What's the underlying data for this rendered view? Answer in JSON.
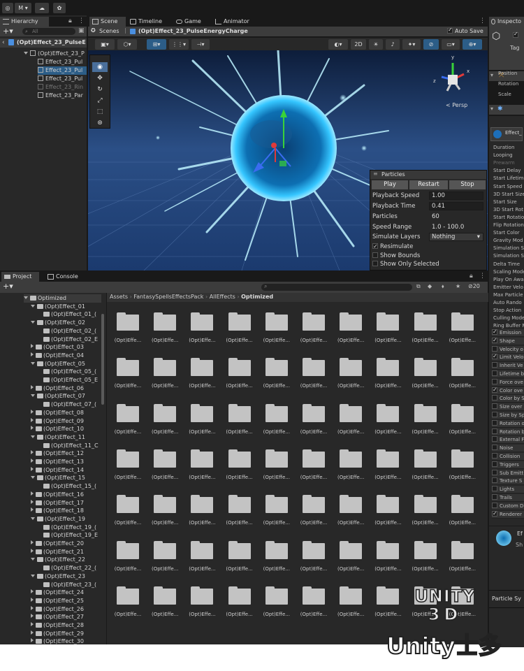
{
  "toolbar": {
    "account": "M",
    "account_caret": "▾",
    "cloud": "☁",
    "gear": "✿"
  },
  "hierarchy": {
    "tab": "Hierarchy",
    "search_placeholder": "All",
    "scene_root": "(Opt)Effect_23_PulseE",
    "rows": [
      "(Opt)Effect_23_P",
      "Effect_23_Pul",
      "Effect_23_Pul",
      "Effect_23_Pul",
      "Effect_23_Rin",
      "Effect_23_Par"
    ]
  },
  "scene": {
    "tabs": [
      "Scene",
      "Timeline",
      "Game",
      "Animator"
    ],
    "breadcrumb_scenes": "Scenes",
    "breadcrumb_prefab": "(Opt)Effect_23_PulseEnergyCharge",
    "auto_save": "Auto Save",
    "mode_2d": "2D",
    "persp": "< Persp",
    "gizmo_axes": {
      "y": "y",
      "x": "x",
      "z": "z"
    }
  },
  "particles_overlay": {
    "title": "Particles",
    "buttons": [
      "Play",
      "Restart",
      "Stop"
    ],
    "fields": [
      {
        "label": "Playback Speed",
        "value": "1.00"
      },
      {
        "label": "Playback Time",
        "value": "0.41"
      },
      {
        "label": "Particles",
        "value": "60"
      },
      {
        "label": "Speed Range",
        "value": "1.0 - 100.0"
      },
      {
        "label": "Simulate Layers",
        "value": "Nothing"
      }
    ],
    "checks": [
      {
        "label": "Resimulate",
        "checked": true
      },
      {
        "label": "Show Bounds",
        "checked": false
      },
      {
        "label": "Show Only Selected",
        "checked": false
      }
    ]
  },
  "inspector": {
    "tab": "Inspecto",
    "tag": "Tag",
    "transform_rows": [
      "Position",
      "Rotation",
      "Scale"
    ],
    "effect_name": "Effect_",
    "main_rows": [
      "Duration",
      "Looping",
      "Prewarm",
      "Start Delay",
      "Start Lifetim",
      "Start Speed",
      "3D Start Size",
      "Start Size",
      "3D Start Rot",
      "Start Rotatio",
      "Flip Rotation",
      "Start Color",
      "Gravity Mod",
      "Simulation S",
      "Simulation S",
      "Delta Time",
      "Scaling Mode",
      "Play On Awa",
      "Emitter Velo",
      "Max Particle",
      "Auto Rando",
      "Stop Action",
      "Culling Mode",
      "Ring Buffer M"
    ],
    "modules": [
      {
        "label": "Emission",
        "checked": true
      },
      {
        "label": "Shape",
        "checked": true
      },
      {
        "label": "Velocity o",
        "checked": false
      },
      {
        "label": "Limit Velo",
        "checked": true
      },
      {
        "label": "Inherit Ve",
        "checked": false
      },
      {
        "label": "Lifetime b",
        "checked": false
      },
      {
        "label": "Force ove",
        "checked": false
      },
      {
        "label": "Color ove",
        "checked": true
      },
      {
        "label": "Color by S",
        "checked": false
      },
      {
        "label": "Size over",
        "checked": false
      },
      {
        "label": "Size by Sp",
        "checked": false
      },
      {
        "label": "Rotation o",
        "checked": false
      },
      {
        "label": "Rotation b",
        "checked": false
      },
      {
        "label": "External F",
        "checked": false
      },
      {
        "label": "Noise",
        "checked": false
      },
      {
        "label": "Collision",
        "checked": false
      },
      {
        "label": "Triggers",
        "checked": false
      },
      {
        "label": "Sub Emitt",
        "checked": false
      },
      {
        "label": "Texture S",
        "checked": false
      },
      {
        "label": "Lights",
        "checked": false
      },
      {
        "label": "Trails",
        "checked": false
      },
      {
        "label": "Custom D",
        "checked": false
      },
      {
        "label": "Renderer",
        "checked": true
      }
    ],
    "material_name": "Ef",
    "material_sub": "Sh",
    "particle_sys": "Particle Sy"
  },
  "project": {
    "tabs": [
      "Project",
      "Console"
    ],
    "breadcrumb": [
      "Assets",
      "FantasySpellsEffectsPack",
      "AllEffects",
      "Optimized"
    ],
    "hidden_count": "20",
    "tree": [
      {
        "label": "Optimized",
        "level": 0,
        "open": true
      },
      {
        "label": "(Opt)Effect_01",
        "level": 1,
        "open": true
      },
      {
        "label": "(Opt)Effect_01_(",
        "level": 2
      },
      {
        "label": "(Opt)Effect_02",
        "level": 1,
        "open": true
      },
      {
        "label": "(Opt)Effect_02_(",
        "level": 2
      },
      {
        "label": "(Opt)Effect_02_E",
        "level": 2
      },
      {
        "label": "(Opt)Effect_03",
        "level": 1
      },
      {
        "label": "(Opt)Effect_04",
        "level": 1
      },
      {
        "label": "(Opt)Effect_05",
        "level": 1,
        "open": true
      },
      {
        "label": "(Opt)Effect_05_(",
        "level": 2
      },
      {
        "label": "(Opt)Effect_05_E",
        "level": 2
      },
      {
        "label": "(Opt)Effect_06",
        "level": 1
      },
      {
        "label": "(Opt)Effect_07",
        "level": 1,
        "open": true
      },
      {
        "label": "(Opt)Effect_07_(",
        "level": 2
      },
      {
        "label": "(Opt)Effect_08",
        "level": 1
      },
      {
        "label": "(Opt)Effect_09",
        "level": 1
      },
      {
        "label": "(Opt)Effect_10",
        "level": 1
      },
      {
        "label": "(Opt)Effect_11",
        "level": 1,
        "open": true
      },
      {
        "label": "(Opt)Effect_11_C",
        "level": 2
      },
      {
        "label": "(Opt)Effect_12",
        "level": 1
      },
      {
        "label": "(Opt)Effect_13",
        "level": 1
      },
      {
        "label": "(Opt)Effect_14",
        "level": 1
      },
      {
        "label": "(Opt)Effect_15",
        "level": 1,
        "open": true
      },
      {
        "label": "(Opt)Effect_15_(",
        "level": 2
      },
      {
        "label": "(Opt)Effect_16",
        "level": 1
      },
      {
        "label": "(Opt)Effect_17",
        "level": 1
      },
      {
        "label": "(Opt)Effect_18",
        "level": 1
      },
      {
        "label": "(Opt)Effect_19",
        "level": 1,
        "open": true
      },
      {
        "label": "(Opt)Effect_19_(",
        "level": 2
      },
      {
        "label": "(Opt)Effect_19_E",
        "level": 2
      },
      {
        "label": "(Opt)Effect_20",
        "level": 1
      },
      {
        "label": "(Opt)Effect_21",
        "level": 1
      },
      {
        "label": "(Opt)Effect_22",
        "level": 1,
        "open": true
      },
      {
        "label": "(Opt)Effect_22_(",
        "level": 2
      },
      {
        "label": "(Opt)Effect_23",
        "level": 1,
        "open": true
      },
      {
        "label": "(Opt)Effect_23_(",
        "level": 2
      },
      {
        "label": "(Opt)Effect_24",
        "level": 1
      },
      {
        "label": "(Opt)Effect_25",
        "level": 1
      },
      {
        "label": "(Opt)Effect_26",
        "level": 1
      },
      {
        "label": "(Opt)Effect_27",
        "level": 1
      },
      {
        "label": "(Opt)Effect_28",
        "level": 1
      },
      {
        "label": "(Opt)Effect_29",
        "level": 1
      },
      {
        "label": "(Opt)Effect_30",
        "level": 1
      }
    ],
    "folder_label": "(Opt)Effe...",
    "grid_rows": 7,
    "grid_cols": 10
  },
  "watermark": {
    "line1": "UNITY",
    "line2": "3D",
    "line3": "Unity士多"
  },
  "colors": {
    "accent_blue": "#4a8fe0",
    "sphere_glow": "#38b8ff",
    "panel_bg": "#282828",
    "dark_bg": "#191919"
  }
}
